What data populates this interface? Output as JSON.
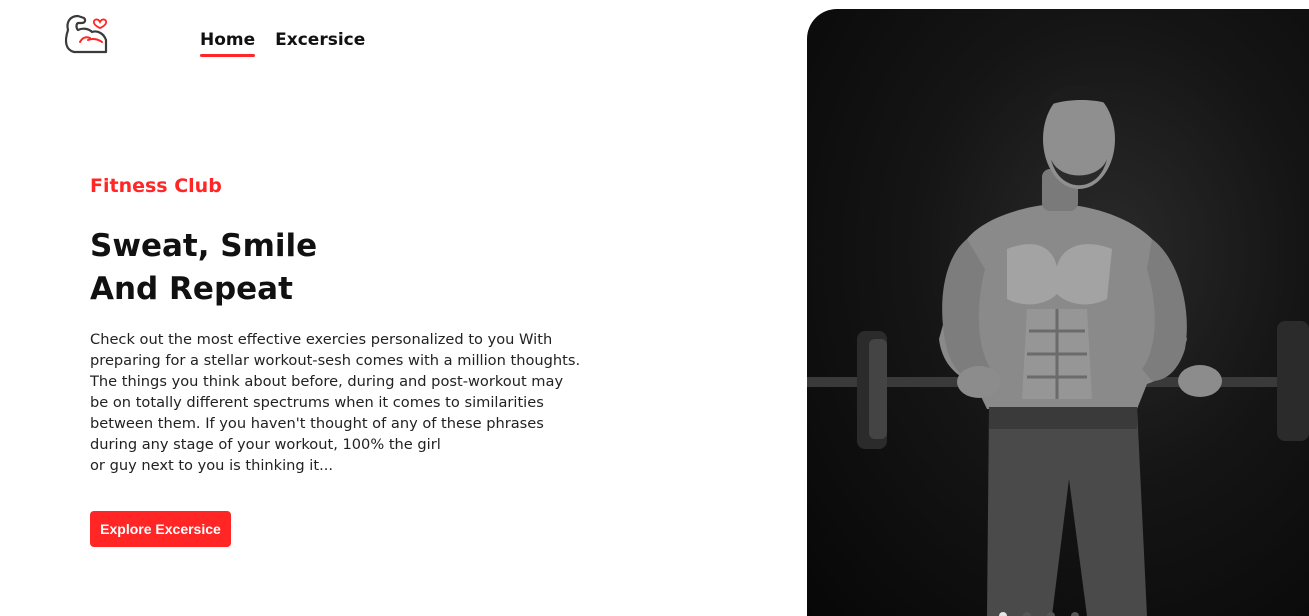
{
  "brand": {
    "logo_icon": "flexed-arm-heart-icon",
    "accent": "#ff2625"
  },
  "nav": {
    "items": [
      {
        "label": "Home",
        "active": true
      },
      {
        "label": "Excersice",
        "active": false
      }
    ]
  },
  "hero": {
    "eyebrow": "Fitness Club",
    "headline": [
      "Sweat, Smile",
      "And Repeat"
    ],
    "description": [
      "Check out the most effective exercies personalized to you With",
      "preparing for a stellar workout-sesh comes with a million thoughts.",
      "The things you think about before, during and post-workout may",
      "be on totally different spectrums when it comes to similarities",
      "between them. If you haven't thought of any of these phrases",
      "during any stage of your workout, 100% the girl",
      "or guy next to you is thinking it..."
    ],
    "cta_label": "Explore Excersice",
    "banner_image": "muscular-man-barbell-curl-photo",
    "carousel": {
      "count": 4,
      "active_index": 0
    }
  }
}
